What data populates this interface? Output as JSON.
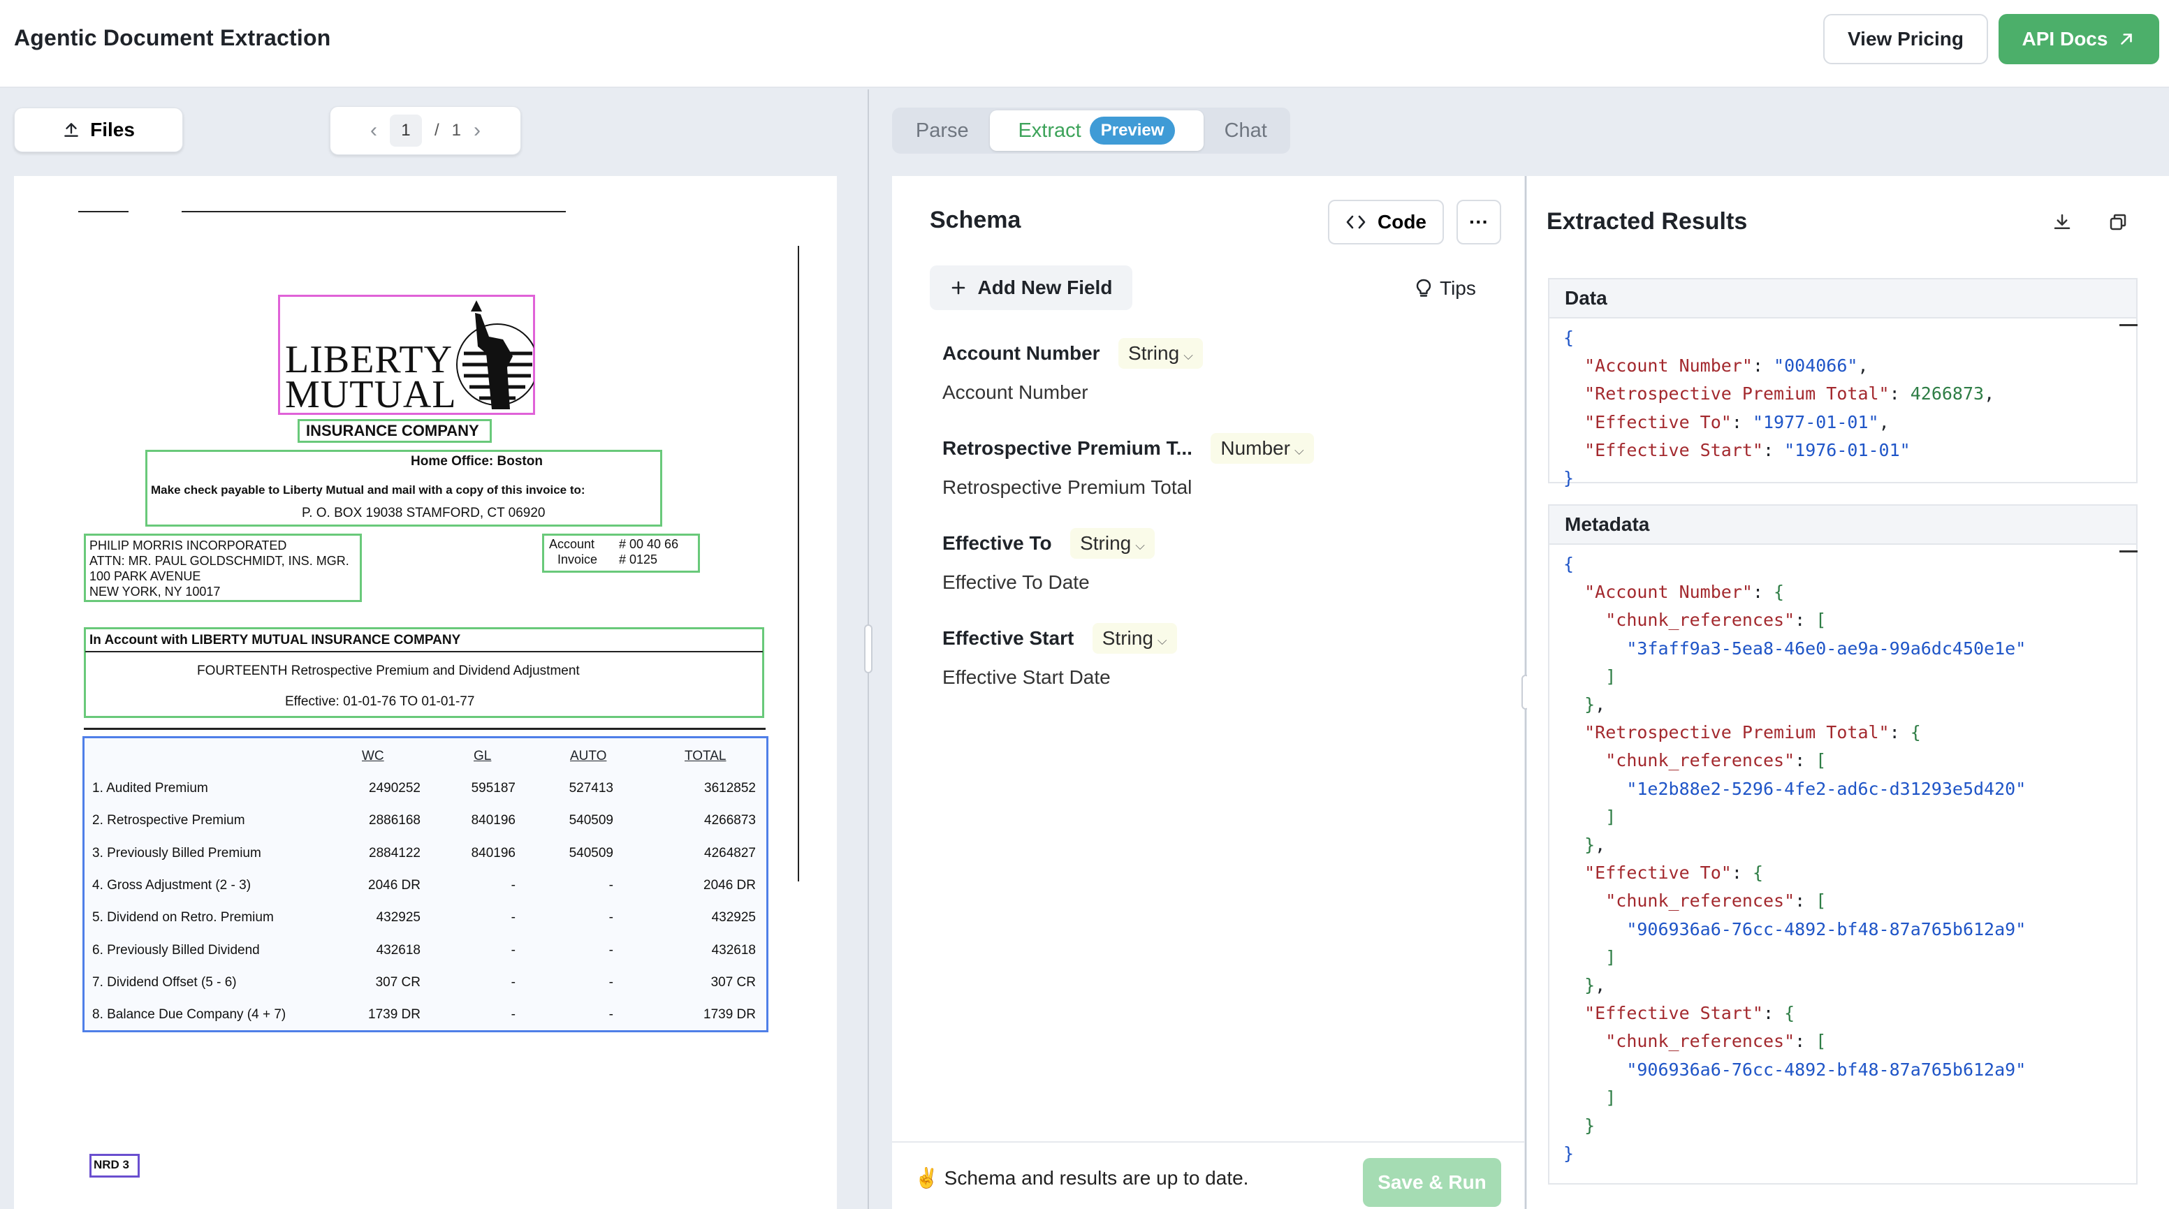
{
  "header": {
    "title": "Agentic Document Extraction",
    "view_pricing": "View Pricing",
    "api_docs": "API Docs"
  },
  "left": {
    "files_label": "Files",
    "pager": {
      "current": "1",
      "separator": "/",
      "total": "1"
    }
  },
  "document": {
    "logo_line1": "LIBERTY",
    "logo_line2": "MUTUAL",
    "company": "INSURANCE COMPANY",
    "home_office": "Home Office: Boston",
    "check_line": "Make check payable to Liberty Mutual and mail with a copy of this invoice to:",
    "po_box": "P. O. BOX 19038 STAMFORD, CT   06920",
    "address": [
      "PHILIP MORRIS INCORPORATED",
      "ATTN: MR. PAUL GOLDSCHMIDT, INS. MGR.",
      "100 PARK AVENUE",
      "NEW YORK, NY  10017"
    ],
    "account_label": "Account",
    "account_value": "# 00 40 66",
    "invoice_label": "Invoice",
    "invoice_value": "# 0125",
    "in_account": "In Account with LIBERTY MUTUAL INSURANCE COMPANY",
    "fourteenth": "FOURTEENTH Retrospective Premium and Dividend  Adjustment",
    "effective": "Effective:    01-01-76  TO  01-01-77",
    "columns": [
      "WC",
      "GL",
      "AUTO",
      "TOTAL"
    ],
    "rows": [
      {
        "label": "1.  Audited  Premium",
        "wc": "2490252",
        "gl": "595187",
        "auto": "527413",
        "total": "3612852"
      },
      {
        "label": "2.  Retrospective  Premium",
        "wc": "2886168",
        "gl": "840196",
        "auto": "540509",
        "total": "4266873"
      },
      {
        "label": "3.  Previously  Billed  Premium",
        "wc": "2884122",
        "gl": "840196",
        "auto": "540509",
        "total": "4264827"
      },
      {
        "label": "4.  Gross  Adjustment  (2 - 3)",
        "wc": "2046 DR",
        "gl": "-",
        "auto": "-",
        "total": "2046 DR"
      },
      {
        "label": "5.  Dividend  on  Retro.  Premium",
        "wc": "432925",
        "gl": "-",
        "auto": "-",
        "total": "432925"
      },
      {
        "label": "6.  Previously  Billed  Dividend",
        "wc": "432618",
        "gl": "-",
        "auto": "-",
        "total": "432618"
      },
      {
        "label": "7.  Dividend  Offset  (5 - 6)",
        "wc": "307 CR",
        "gl": "-",
        "auto": "-",
        "total": "307 CR"
      },
      {
        "label": "8.  Balance  Due  Company  (4 + 7)",
        "wc": "1739 DR",
        "gl": "-",
        "auto": "-",
        "total": "1739 DR"
      }
    ],
    "nrd": "NRD 3"
  },
  "tabs": {
    "parse": "Parse",
    "extract": "Extract",
    "preview": "Preview",
    "chat": "Chat"
  },
  "schema": {
    "title": "Schema",
    "code": "Code",
    "more": "···",
    "add_field": "Add New Field",
    "tips": "Tips",
    "fields": [
      {
        "name": "Account Number",
        "type": "String",
        "desc": "Account Number"
      },
      {
        "name": "Retrospective Premium T...",
        "type": "Number",
        "desc": "Retrospective Premium Total"
      },
      {
        "name": "Effective To",
        "type": "String",
        "desc": "Effective To Date"
      },
      {
        "name": "Effective Start",
        "type": "String",
        "desc": "Effective Start Date"
      }
    ],
    "status": "✌️ Schema and results are up to date.",
    "save_run": "Save & Run"
  },
  "results": {
    "title": "Extracted Results",
    "data_label": "Data",
    "metadata_label": "Metadata",
    "data": {
      "account_number_key": "\"Account Number\"",
      "account_number_val": "\"004066\"",
      "retro_key": "\"Retrospective Premium Total\"",
      "retro_val": "4266873",
      "eff_to_key": "\"Effective To\"",
      "eff_to_val": "\"1977-01-01\"",
      "eff_start_key": "\"Effective Start\"",
      "eff_start_val": "\"1976-01-01\""
    },
    "metadata": {
      "chunk_key": "\"chunk_references\"",
      "account_ref": "\"3faff9a3-5ea8-46e0-ae9a-99a6dc450e1e\"",
      "retro_ref": "\"1e2b88e2-5296-4fe2-ad6c-d31293e5d420\"",
      "eff_to_ref": "\"906936a6-76cc-4892-bf48-87a765b612a9\"",
      "eff_start_ref": "\"906936a6-76cc-4892-bf48-87a765b612a9\""
    }
  }
}
